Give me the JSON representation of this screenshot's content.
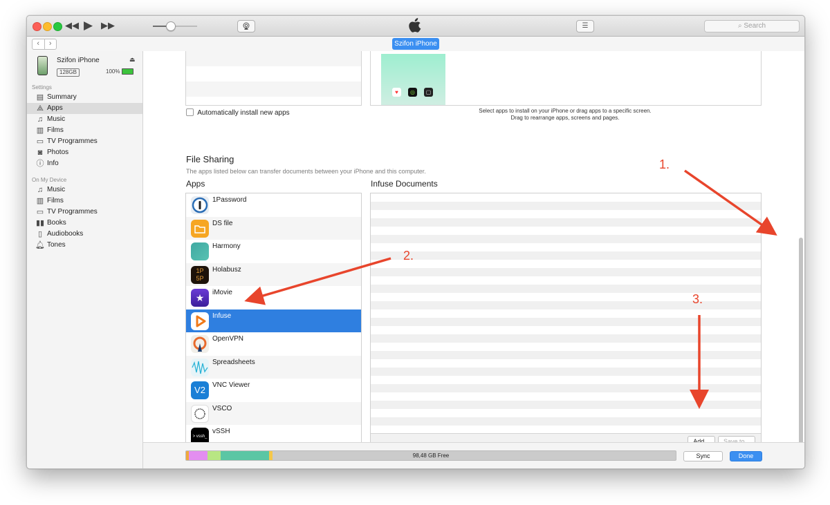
{
  "toolbar": {
    "search_placeholder": "Search",
    "device_pill": "Szifon iPhone"
  },
  "device": {
    "name": "Szifon iPhone",
    "capacity": "128GB",
    "battery": "100%"
  },
  "sidebar": {
    "settings_header": "Settings",
    "settings_items": [
      "Summary",
      "Apps",
      "Music",
      "Films",
      "TV Programmes",
      "Photos",
      "Info"
    ],
    "selected": "Apps",
    "on_device_header": "On My Device",
    "device_items": [
      "Music",
      "Films",
      "TV Programmes",
      "Books",
      "Audiobooks",
      "Tones"
    ]
  },
  "apps_section": {
    "auto_install_label": "Automatically install new apps",
    "hint_line1": "Select apps to install on your iPhone or drag apps to a specific screen.",
    "hint_line2": "Drag to rearrange apps, screens and pages."
  },
  "file_sharing": {
    "title": "File Sharing",
    "description": "The apps listed below can transfer documents between your iPhone and this computer.",
    "apps_header": "Apps",
    "documents_header": "Infuse Documents",
    "apps": [
      "1Password",
      "DS file",
      "Harmony",
      "Holabusz",
      "iMovie",
      "Infuse",
      "OpenVPN",
      "Spreadsheets",
      "VNC Viewer",
      "VSCO",
      "vSSH"
    ],
    "selected_app": "Infuse",
    "add_button": "Add...",
    "save_button": "Save to..."
  },
  "bottom": {
    "free_space": "98,48 GB Free",
    "sync_button": "Sync",
    "done_button": "Done"
  },
  "annotations": [
    "1.",
    "2.",
    "3."
  ],
  "colors": {
    "accent": "#3b8ff1",
    "selection": "#2f7fe0",
    "annotation": "#e8452c"
  }
}
